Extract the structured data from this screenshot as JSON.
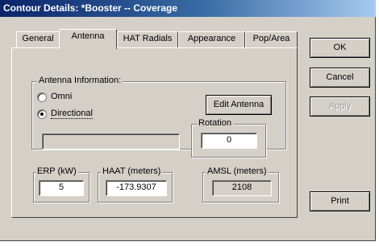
{
  "window": {
    "title": "Contour Details: *Booster -- Coverage"
  },
  "tabs": [
    {
      "label": "General"
    },
    {
      "label": "Antenna"
    },
    {
      "label": "HAT Radials"
    },
    {
      "label": "Appearance"
    },
    {
      "label": "Pop/Area"
    }
  ],
  "active_tab": "Antenna",
  "antenna_info": {
    "legend": "Antenna Information:",
    "options": [
      {
        "label": "Omni",
        "selected": false
      },
      {
        "label": "Directional",
        "selected": true
      }
    ],
    "edit_button": "Edit Antenna",
    "antenna_name_value": ""
  },
  "rotation": {
    "legend": "Rotation",
    "value": "0"
  },
  "erp": {
    "legend": "ERP (kW)",
    "value": "5"
  },
  "haat": {
    "legend": "HAAT (meters)",
    "value": "-173.9307"
  },
  "amsl": {
    "legend": "AMSL (meters)",
    "value": "2108"
  },
  "buttons": {
    "ok": "OK",
    "cancel": "Cancel",
    "apply": "Apply",
    "print": "Print"
  }
}
